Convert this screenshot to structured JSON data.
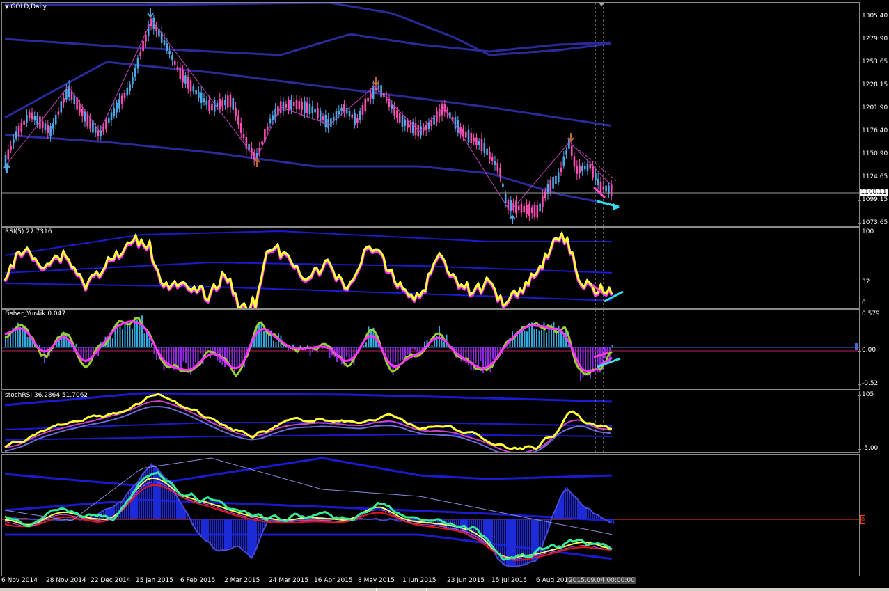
{
  "chart_window": {
    "symbol_label": "GOLD,Daily"
  },
  "price_panel": {
    "price_axis": [
      "1305.40",
      "1279.90",
      "1253.65",
      "1228.15",
      "1201.90",
      "1176.40",
      "1150.90",
      "1124.65",
      "1099.15",
      "1073.65"
    ],
    "current_price": "1108.11"
  },
  "rsi_panel": {
    "label": "RSI(5) 27.7316",
    "axis": [
      "100",
      "32",
      "0"
    ]
  },
  "fisher_panel": {
    "label": "Fisher_Yur4ik 0.047",
    "axis": [
      "0.579",
      "0.00",
      "-0.52"
    ]
  },
  "stochrsi_panel": {
    "label": "stochRSI 36.2864 51.7062",
    "axis": [
      "105",
      "-5.00"
    ]
  },
  "bottom_panel": {
    "axis_marker": "0"
  },
  "time_axis": {
    "labels": [
      "6 Nov 2014",
      "28 Nov 2014",
      "22 Dec 2014",
      "15 Jan 2015",
      "6 Feb 2015",
      "2 Mar 2015",
      "24 Mar 2015",
      "16 Apr 2015",
      "8 May 2015",
      "1 Jun 2015",
      "23 Jun 2015",
      "15 Jul 2015",
      "6 Aug 2015"
    ],
    "cursor_date": "2015.09.04 00:00:00"
  },
  "colors": {
    "background": "#000000",
    "bull_candle": "#4fa8e8",
    "bear_candle": "#ff4fb4",
    "bands": "#2a2a9a",
    "rsi_main": "#ffff33",
    "rsi_magenta": "#ff33ff",
    "fisher_green": "#9acd32",
    "fisher_magenta": "#ff33ff",
    "hist_up": "#33aadd",
    "hist_down": "#8a2be2",
    "arrow_cyan": "#33ddee",
    "arrow_magenta": "#ff44cc"
  }
}
